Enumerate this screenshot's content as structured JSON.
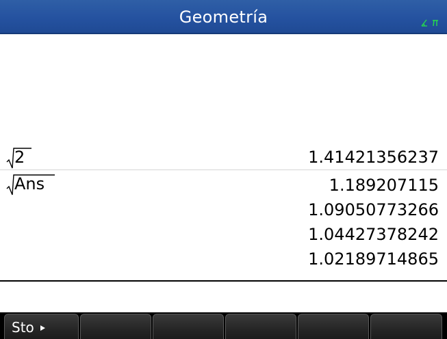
{
  "app": {
    "title": "Geometría",
    "angle_mode_indicator": "∡π",
    "colors": {
      "titlebar": "#2552a0",
      "indicator": "#26e04a",
      "menubar": "#000000"
    }
  },
  "history": {
    "entries": [
      {
        "expression": "2",
        "expression_icon": "square-root-icon",
        "results": [
          "1.41421356237"
        ]
      },
      {
        "expression": "Ans",
        "expression_icon": "square-root-icon",
        "results": [
          "1.189207115",
          "1.09050773266",
          "1.04427378242",
          "1.02189714865"
        ]
      }
    ]
  },
  "menu": {
    "softkeys": [
      {
        "label": "Sto",
        "icon": "right-triangle-icon"
      },
      {
        "label": ""
      },
      {
        "label": ""
      },
      {
        "label": ""
      },
      {
        "label": ""
      },
      {
        "label": ""
      }
    ]
  }
}
